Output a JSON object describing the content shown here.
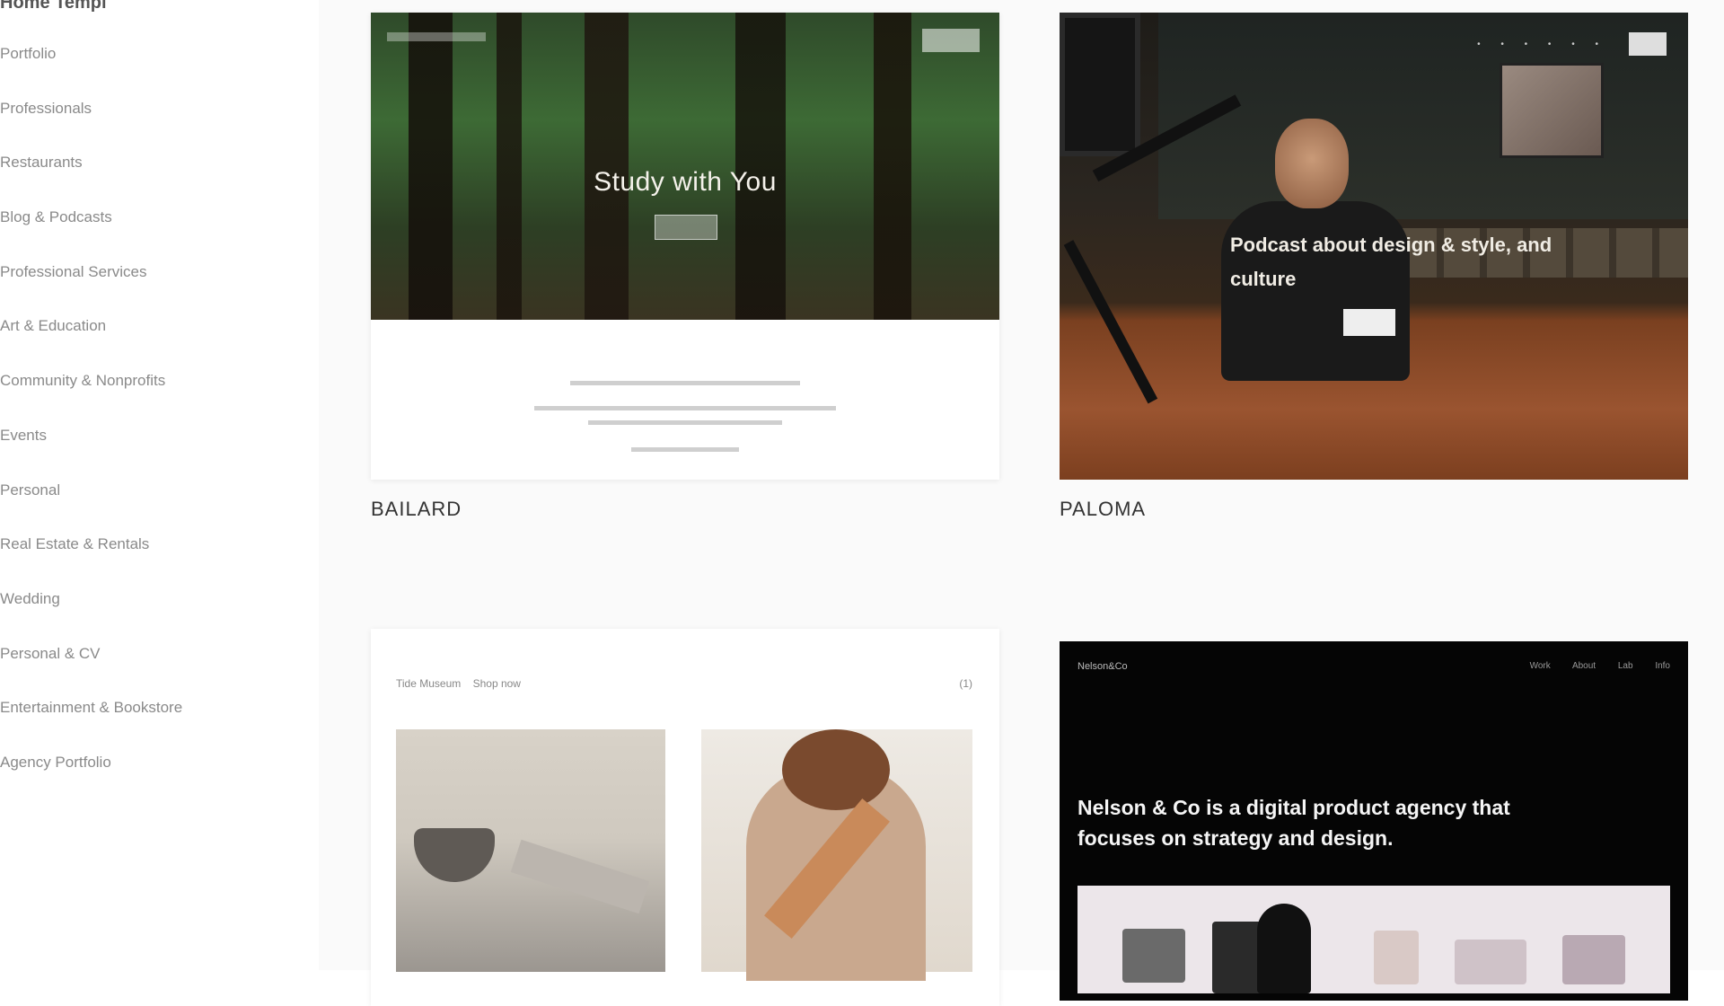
{
  "sidebar": {
    "heading": "Home Templ",
    "categories": [
      "Portfolio",
      "Professionals",
      "Restaurants",
      "Blog & Podcasts",
      "Professional Services",
      "Art & Education",
      "Community & Nonprofits",
      "Events",
      "Personal",
      "Real Estate & Rentals",
      "Wedding",
      "Personal & CV",
      "Entertainment & Bookstore",
      "Agency Portfolio"
    ]
  },
  "templates": [
    {
      "label": "BAILARD",
      "hero_title": "Study with You",
      "theme": "forest"
    },
    {
      "label": "PALOMA",
      "overlay": "Podcast about design & style, and culture",
      "theme": "podcast"
    },
    {
      "label": "",
      "brand": "Tide Museum",
      "brand_sub": "Shop now",
      "cart": "(1)",
      "theme": "shop"
    },
    {
      "label": "",
      "logo": "Nelson&Co",
      "nav": "Work About Lab Info",
      "headline": "Nelson & Co is a digital product agency that focuses on strategy and design.",
      "theme": "agency"
    }
  ],
  "colors": {
    "background": "#ffffff",
    "canvas": "#fafafa",
    "text": "#333333",
    "muted": "#8a8a8a"
  }
}
